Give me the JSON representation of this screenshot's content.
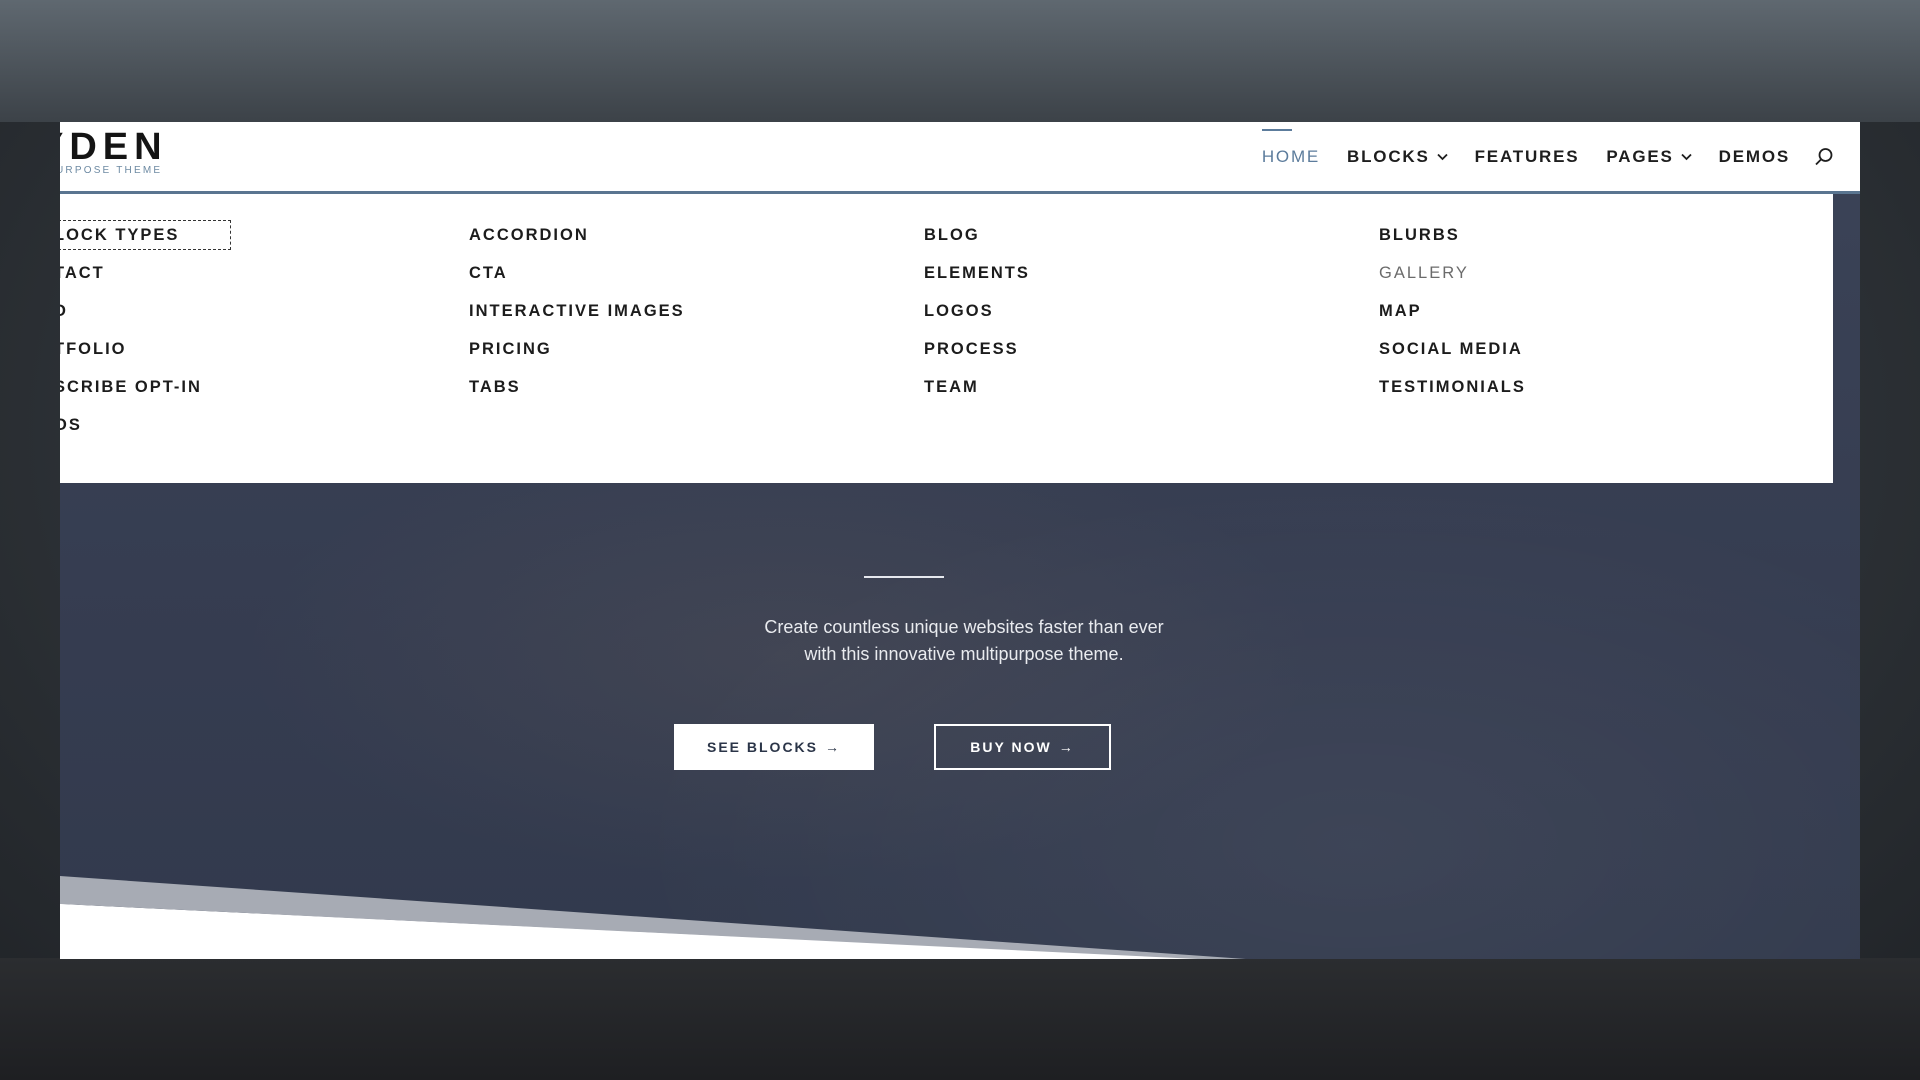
{
  "logo": {
    "name": "YDEN",
    "tagline": "URPOSE THEME"
  },
  "nav": {
    "items": [
      {
        "label": "HOME",
        "active": true,
        "has_dropdown": false
      },
      {
        "label": "BLOCKS",
        "active": false,
        "has_dropdown": true
      },
      {
        "label": "FEATURES",
        "active": false,
        "has_dropdown": false
      },
      {
        "label": "PAGES",
        "active": false,
        "has_dropdown": true
      },
      {
        "label": "DEMOS",
        "active": false,
        "has_dropdown": false
      }
    ],
    "search_icon": "search-icon",
    "accent_color": "#5c7c9c"
  },
  "mega_menu": {
    "columns": [
      [
        "LOCK TYPES",
        "TACT",
        "D",
        "TFOLIO",
        "SCRIBE OPT-IN",
        "OS"
      ],
      [
        "ACCORDION",
        "CTA",
        "INTERACTIVE IMAGES",
        "PRICING",
        "TABS"
      ],
      [
        "BLOG",
        "ELEMENTS",
        "LOGOS",
        "PROCESS",
        "TEAM"
      ],
      [
        "BLURBS",
        "GALLERY",
        "MAP",
        "SOCIAL MEDIA",
        "TESTIMONIALS"
      ]
    ],
    "focused_item": "LOCK TYPES",
    "muted_item": "GALLERY"
  },
  "hero": {
    "description_line1": "Create countless unique websites faster than ever",
    "description_line2": "with this innovative multipurpose theme.",
    "see_blocks_label": "SEE BLOCKS",
    "buy_now_label": "BUY NOW",
    "arrow": "→",
    "background_color": "#353c50"
  }
}
